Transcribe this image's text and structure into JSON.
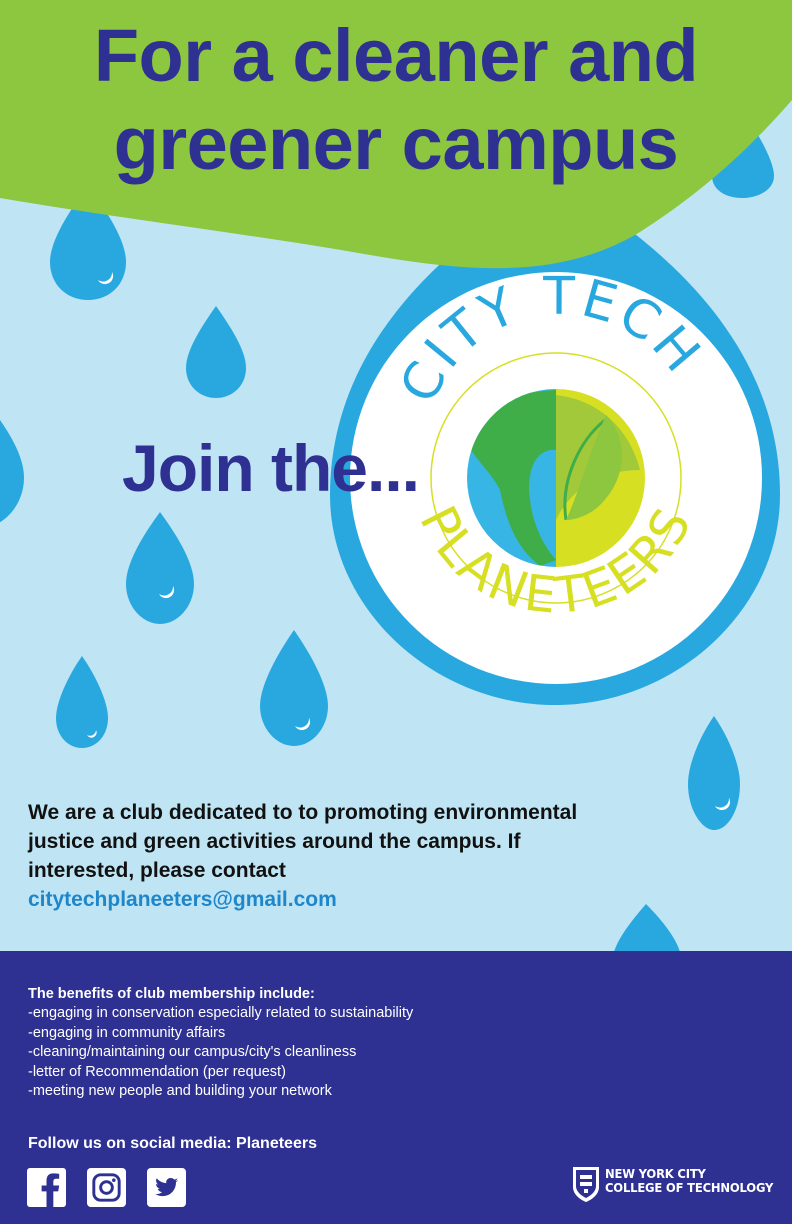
{
  "headline": {
    "line1": "For a cleaner and",
    "line2": "greener campus"
  },
  "join_text": "Join the...",
  "logo": {
    "top_text": "CITY TECH",
    "bottom_text": "PLANETEERS"
  },
  "intro": {
    "text": "We are a club dedicated to to promoting environmental justice and green activities around the campus. If interested, please contact",
    "email": "citytechplaneeters@gmail.com"
  },
  "benefits": {
    "heading": "The benefits of club membership include:",
    "items": [
      "-engaging in conservation especially related to sustainability",
      "-engaging in community affairs",
      "-cleaning/maintaining our campus/city's cleanliness",
      "-letter of Recommendation (per request)",
      "-meeting new people and building your network"
    ]
  },
  "social": {
    "label": "Follow us on social media: Planeteers",
    "icons": [
      "facebook-icon",
      "instagram-icon",
      "twitter-icon"
    ]
  },
  "college": {
    "line1": "NEW YORK CITY",
    "line2": "COLLEGE OF TECHNOLOGY"
  },
  "colors": {
    "navy": "#2e3192",
    "green": "#8dc63f",
    "sky": "#bfe5f5",
    "drop": "#29a8e0",
    "link": "#1f86c9",
    "logo_yellow": "#d7df23"
  }
}
